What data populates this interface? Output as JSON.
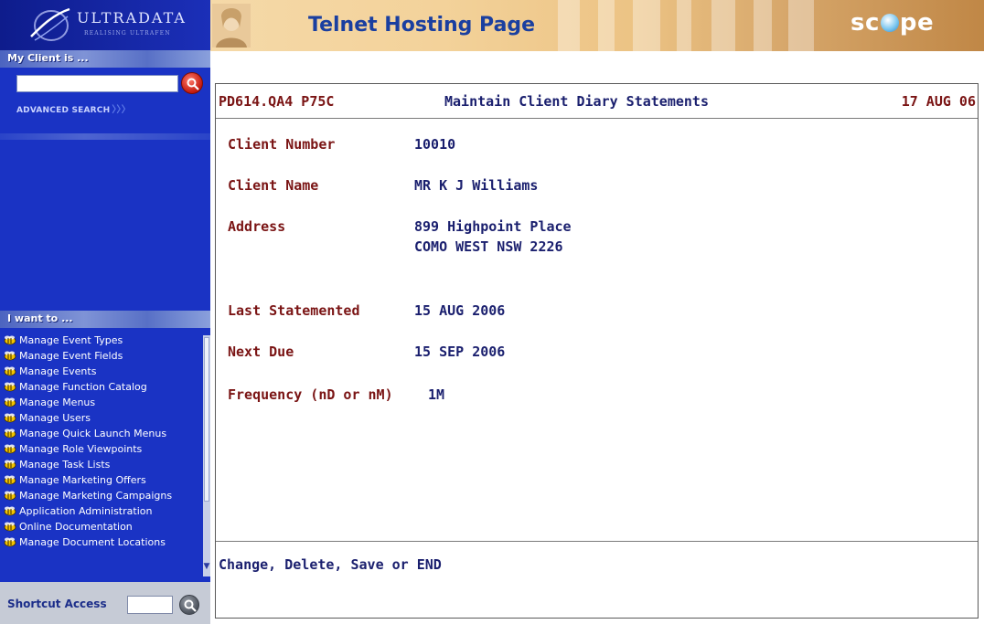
{
  "sidebar": {
    "logo_text": "ULTRADATA",
    "logo_tagline": "REALISING ULTRAFEN",
    "client_heading": "My Client is ...",
    "search": {
      "value": "",
      "placeholder": ""
    },
    "advanced_search": "ADVANCED SEARCH",
    "advanced_search_chevrons": "〉〉〉",
    "iwant_heading": "I want to ...",
    "menu_items": [
      "Manage Event Types",
      "Manage Event Fields",
      "Manage Events",
      "Manage Function Catalog",
      "Manage Menus",
      "Manage Users",
      "Manage Quick Launch Menus",
      "Manage Role Viewpoints",
      "Manage Task Lists",
      "Manage Marketing Offers",
      "Manage Marketing Campaigns",
      "Application Administration",
      "Online Documentation",
      "Manage Document Locations"
    ],
    "shortcut_label": "Shortcut Access",
    "shortcut_value": ""
  },
  "header": {
    "title": "Telnet Hosting Page",
    "brand_pre": "sc",
    "brand_post": "pe"
  },
  "terminal": {
    "program": "PD614.QA4 P75C",
    "title": "Maintain Client Diary Statements",
    "date": "17 AUG 06",
    "fields": {
      "client_number": {
        "label": "Client Number",
        "value": "10010"
      },
      "client_name": {
        "label": "Client Name",
        "value": "MR K J Williams"
      },
      "address": {
        "label": "Address",
        "line1": "899 Highpoint Place",
        "line2": "COMO WEST NSW 2226"
      },
      "last_statemented": {
        "label": "Last Statemented",
        "value": "15 AUG 2006"
      },
      "next_due": {
        "label": "Next Due",
        "value": "15 SEP 2006"
      },
      "frequency": {
        "label": "Frequency (nD or nM)",
        "value": "1M"
      }
    },
    "prompt": "Change, Delete, Save or END"
  },
  "colors": {
    "sidebar_bg": "#1a33c4",
    "header_title": "#1a3fa0",
    "terminal_label": "#7a1414",
    "terminal_value": "#1a1f6e"
  }
}
